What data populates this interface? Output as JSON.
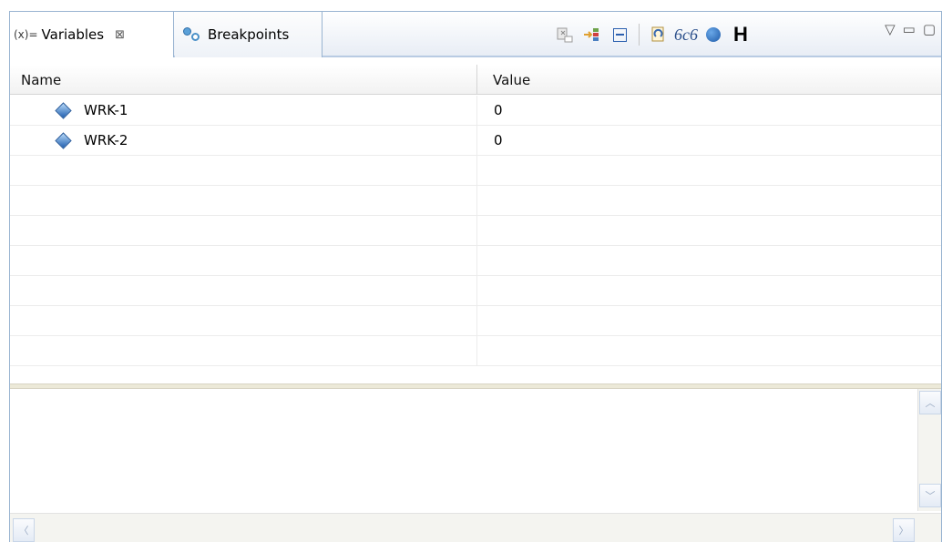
{
  "tabs": [
    {
      "icon_text": "(x)=",
      "label": "Variables",
      "active": true,
      "close": "⊠"
    },
    {
      "label": "Breakpoints",
      "active": false
    }
  ],
  "toolbar": {
    "icons": [
      "show-type-names-icon",
      "show-logical-structure-icon",
      "collapse-all-icon",
      "refresh-icon",
      "watch-glasses-icon",
      "blue-dot-icon",
      "hex-icon"
    ],
    "hex_label": "H",
    "glasses_text": "6c6"
  },
  "window_controls": {
    "menu": "▽",
    "minimize": "▭",
    "maximize": "▢"
  },
  "table": {
    "columns": [
      "Name",
      "Value"
    ],
    "rows": [
      {
        "name": "WRK-1",
        "value": "0"
      },
      {
        "name": "WRK-2",
        "value": "0"
      }
    ],
    "empty_row_count": 8
  },
  "scrollbars": {
    "up": "︿",
    "down": "﹀",
    "left": "〈",
    "right": "〉"
  }
}
